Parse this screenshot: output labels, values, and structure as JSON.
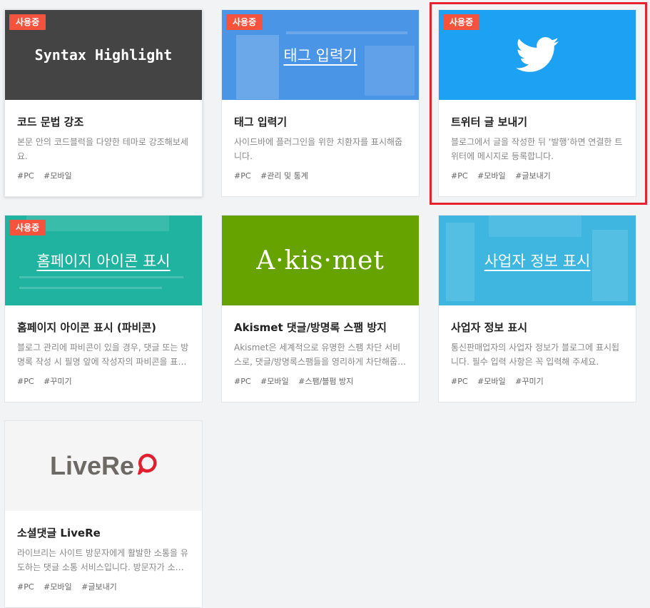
{
  "status_badge": "사용중",
  "cards": [
    {
      "thumb_text": "Syntax Highlight",
      "title": "코드 문법 강조",
      "desc": "본문 안의 코드블럭을 다양한 테마로 강조해보세요.",
      "tags": [
        "#PC",
        "#모바일"
      ],
      "in_use": true,
      "thumb_color": "#444444"
    },
    {
      "thumb_text": "태그 입력기",
      "title": "태그 입력기",
      "desc": "사이드바에 플러그인을 위한 치환자를 표시해줍니다.",
      "tags": [
        "#PC",
        "#관리 및 통계"
      ],
      "in_use": true,
      "thumb_color": "#4a95e6"
    },
    {
      "thumb_icon": "twitter-bird-icon",
      "title": "트위터 글 보내기",
      "desc": "블로그에서 글을 작성한 뒤 ‘발행’하면 연결한 트위터에 메시지로 등록합니다.",
      "tags": [
        "#PC",
        "#모바일",
        "#글보내기"
      ],
      "in_use": true,
      "selected": true,
      "thumb_color": "#1da1f2"
    },
    {
      "thumb_text": "홈페이지 아이콘 표시",
      "title": "홈페이지 아이콘 표시 (파비콘)",
      "desc": "블로그 관리에 파비콘이 있을 경우, 댓글 또는 방명록 작성 시 필명 앞에 작성자의 파비콘을 표시합니다.",
      "tags": [
        "#PC",
        "#꾸미기"
      ],
      "in_use": true,
      "thumb_color": "#1fb3a0"
    },
    {
      "thumb_text": "A·kis·met",
      "title": "Akismet 댓글/방명록 스팸 방지",
      "desc": "Akismet은 세계적으로 유명한 스팸 차단 서비스로, 댓글/방명록스팸들을 영리하게 차단해줍니다.",
      "tags": [
        "#PC",
        "#모바일",
        "#스팸/블펌 방지"
      ],
      "in_use": false,
      "thumb_color": "#66a300"
    },
    {
      "thumb_text": "사업자 정보 표시",
      "title": "사업자 정보 표시",
      "desc": "통신판매업자의 사업자 정보가 블로그에 표시됩니다. 필수 입력 사항은 꼭 입력해 주세요.",
      "tags": [
        "#PC",
        "#모바일",
        "#꾸미기"
      ],
      "in_use": false,
      "thumb_color": "#3eb6e0"
    },
    {
      "thumb_text": "LiveRe",
      "title": "소셜댓글 LiveRe",
      "desc": "라이브리는 사이트 방문자에게 활발한 소통을 유도하는 댓글 소통 서비스입니다. 방문자가 소셜 계정으로 댓글을 남길 수 있습니다.",
      "tags": [
        "#PC",
        "#모바일",
        "#글보내기"
      ],
      "in_use": false,
      "thumb_color": "#f5f5f5"
    }
  ]
}
